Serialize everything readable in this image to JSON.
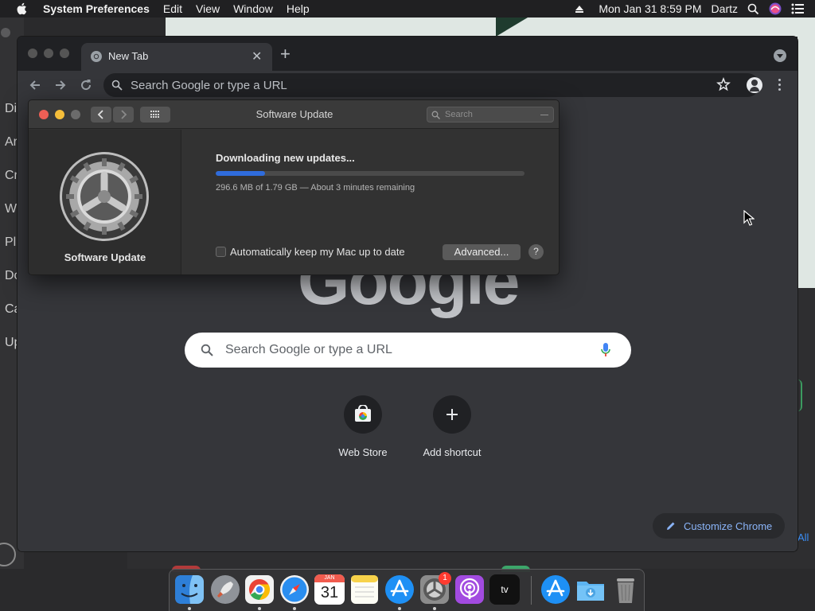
{
  "menubar": {
    "app_name": "System Preferences",
    "items": [
      "Edit",
      "View",
      "Window",
      "Help"
    ],
    "datetime": "Mon Jan 31  8:59 PM",
    "user": "Dartz"
  },
  "background": {
    "sidebar_fragments": [
      "Di",
      "Ar",
      "Cr",
      "W",
      "Pl",
      "Do",
      "Ca",
      "Up"
    ],
    "all_link": "All"
  },
  "chrome": {
    "tab_title": "New Tab",
    "omnibox_placeholder": "Search Google or type a URL",
    "google_logo": "Google",
    "search_placeholder": "Search Google or type a URL",
    "shortcuts": [
      {
        "label": "Web Store"
      },
      {
        "label": "Add shortcut"
      }
    ],
    "customize_label": "Customize Chrome"
  },
  "software_update": {
    "window_title": "Software Update",
    "search_placeholder": "Search",
    "sidebar_label": "Software Update",
    "downloading_title": "Downloading new updates...",
    "progress_fraction": 0.16,
    "status_text": "296.6 MB of 1.79 GB — About 3 minutes remaining",
    "auto_update_label": "Automatically keep my Mac up to date",
    "auto_update_checked": false,
    "advanced_button": "Advanced...",
    "help_button": "?"
  },
  "dock": {
    "apps": [
      "finder-icon",
      "launchpad-icon",
      "chrome-icon",
      "safari-icon",
      "calendar-icon",
      "notes-icon",
      "app-store-icon",
      "system-preferences-icon",
      "podcasts-icon",
      "apple-tv-icon",
      "app-store-icon",
      "downloads-folder-icon",
      "trash-icon"
    ],
    "calendar_month": "JAN",
    "calendar_day": "31",
    "sysprefs_badge": "1",
    "tv_label": "tv"
  },
  "colors": {
    "progress_fill": "#2f6cdc",
    "link_blue": "#8ab4f8",
    "close_red": "#ed5f55",
    "minimize_yellow": "#f5be3a",
    "zoom_gray": "#6b6b6b"
  }
}
